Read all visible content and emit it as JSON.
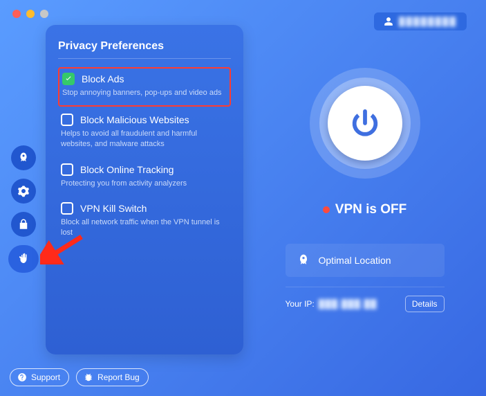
{
  "user_name": "████████",
  "panel": {
    "title": "Privacy Preferences",
    "items": [
      {
        "title": "Block Ads",
        "desc": "Stop annoying banners, pop-ups and video ads",
        "checked": true
      },
      {
        "title": "Block Malicious Websites",
        "desc": "Helps to avoid all fraudulent and harmful websites, and malware attacks",
        "checked": false
      },
      {
        "title": "Block Online Tracking",
        "desc": "Protecting you from activity analyzers",
        "checked": false
      },
      {
        "title": "VPN Kill Switch",
        "desc": "Block all network traffic when the VPN tunnel is lost",
        "checked": false
      }
    ]
  },
  "status_text": "VPN is OFF",
  "location_label": "Optimal Location",
  "ip_label": "Your IP:",
  "ip_value": "███.███.██",
  "details_label": "Details",
  "support_label": "Support",
  "report_label": "Report Bug"
}
